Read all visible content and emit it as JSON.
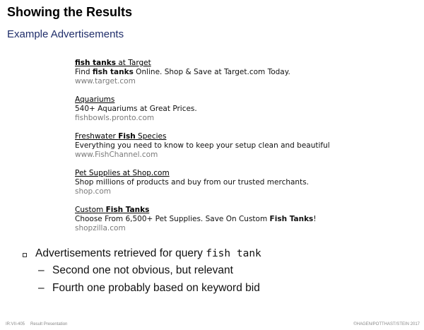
{
  "slide": {
    "title": "Showing the Results",
    "subtitle": "Example Advertisements"
  },
  "ads": [
    {
      "title_bold": "fish tanks",
      "title_rest": " at Target",
      "desc_pre": "Find ",
      "desc_bold": "fish tanks",
      "desc_post": " Online. Shop & Save at Target.com Today.",
      "url": "www.target.com"
    },
    {
      "title": "Aquariums",
      "desc": "540+ Aquariums at Great Prices.",
      "url": "fishbowls.pronto.com"
    },
    {
      "title_pre": "Freshwater ",
      "title_bold": "Fish",
      "title_post": " Species",
      "desc": "Everything you need to know to keep your setup clean and beautiful",
      "url": "www.FishChannel.com"
    },
    {
      "title": "Pet Supplies at Shop.com",
      "desc": "Shop millions of products and buy from our trusted merchants.",
      "url": "shop.com"
    },
    {
      "title_pre": "Custom ",
      "title_bold": "Fish Tanks",
      "desc_pre": "Choose From 6,500+ Pet Supplies. Save On Custom ",
      "desc_bold": "Fish Tanks",
      "desc_post": "!",
      "url": "shopzilla.com"
    }
  ],
  "bullets": {
    "main_text": "Advertisements retrieved for query ",
    "query": "fish tank",
    "sub": [
      "Second one not obvious, but relevant",
      "Fourth one probably based on keyword bid"
    ]
  },
  "footer": {
    "left_code": "IR:VII-405",
    "left_topic": "Result Presentation",
    "right": "©HAGEN/POTTHAST/STEIN 2017"
  }
}
